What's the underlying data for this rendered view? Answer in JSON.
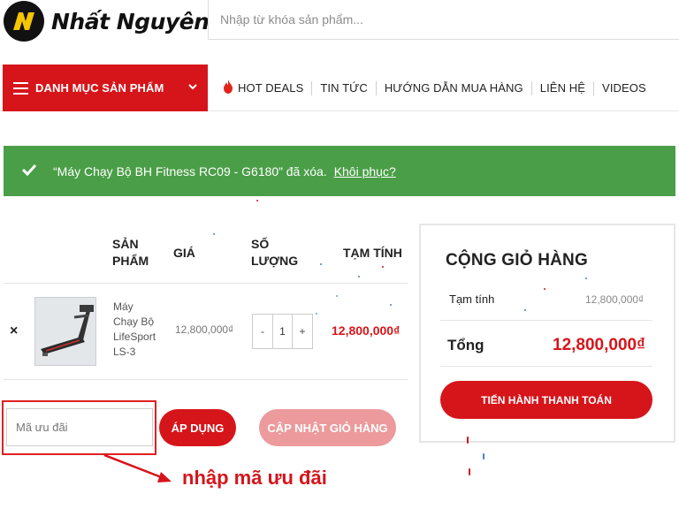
{
  "header": {
    "brand": "Nhất Nguyên",
    "search_placeholder": "Nhập từ khóa sản phẩm..."
  },
  "nav": {
    "category_label": "DANH MỤC SẢN PHẨM",
    "links": [
      "HOT DEALS",
      "TIN TỨC",
      "HƯỚNG DẪN MUA HÀNG",
      "LIÊN HỆ",
      "VIDEOS"
    ]
  },
  "notice": {
    "message": "“Máy Chạy Bộ BH Fitness RC09 - G6180” đã xóa.",
    "restore_link": "Khôi phục?"
  },
  "cart": {
    "columns": {
      "product_line1": "SẢN",
      "product_line2": "PHẨM",
      "price": "GIÁ",
      "qty_line1": "SỐ",
      "qty_line2": "LƯỢNG",
      "subtotal": "TẠM TÍNH"
    },
    "remove_symbol": "×",
    "item": {
      "name_lines": [
        "Máy",
        "Chạy Bộ",
        "LifeSport",
        "LS-3"
      ],
      "price": "12,800,000₫",
      "qty_minus": "-",
      "quantity": "1",
      "qty_plus": "+",
      "subtotal": "12,800,000₫"
    },
    "coupon_placeholder": "Mã ưu đãi",
    "apply_label": "ÁP DỤNG",
    "update_label": "CẬP NHẬT GIỎ HÀNG"
  },
  "annotation": "nhập mã ưu đãi",
  "totals": {
    "title": "CỘNG GIỎ HÀNG",
    "subtotal_label": "Tạm tính",
    "subtotal_value": "12,800,000₫",
    "total_label": "Tổng",
    "total_value": "12,800,000₫",
    "checkout_label": "TIẾN HÀNH THANH TOÁN"
  },
  "colors": {
    "brand_red": "#d6151b",
    "notice_green": "#4a9e47",
    "update_pink": "#ec9a9c",
    "logo_yellow": "#f5c500"
  }
}
